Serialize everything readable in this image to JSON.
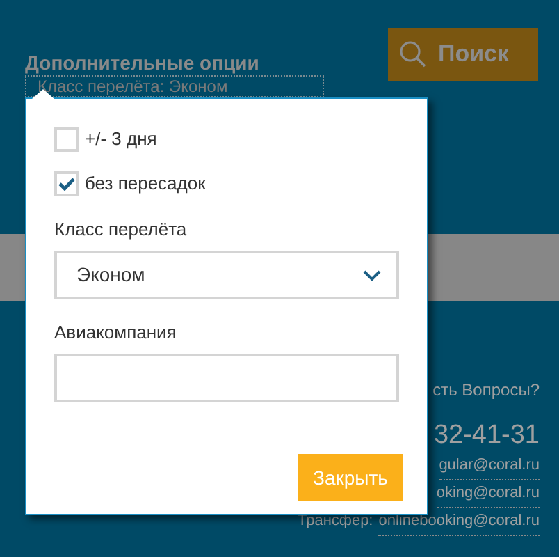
{
  "section_title": "Дополнительные опции",
  "summary": "Класс перелёта: Эконом",
  "search_button": "Поиск",
  "contacts": {
    "question": "сть Вопросы?",
    "phone": "32-41-31",
    "emails": [
      {
        "link": "gular@coral.ru"
      },
      {
        "link": "oking@coral.ru"
      },
      {
        "prefix": "Трансфер:",
        "link": "onlinebooking@coral.ru"
      }
    ]
  },
  "popup": {
    "options": [
      {
        "label": "+/- 3 дня",
        "checked": false
      },
      {
        "label": "без пересадок",
        "checked": true
      }
    ],
    "class_label": "Класс перелёта",
    "class_value": "Эконом",
    "airline_label": "Авиакомпания",
    "close_button": "Закрыть"
  }
}
